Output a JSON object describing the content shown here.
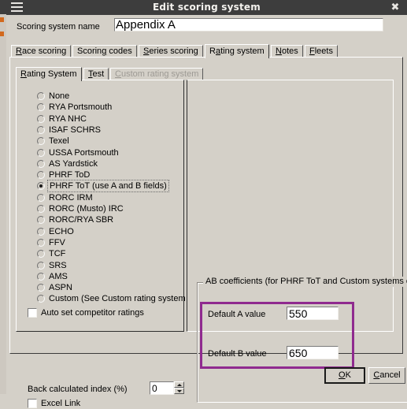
{
  "window": {
    "title": "Edit scoring system",
    "menu_icon": "hamburger-menu-icon",
    "close_icon": "✖"
  },
  "name_row": {
    "label": "Scoring system name",
    "value": "Appendix A",
    "placeholder": ""
  },
  "outer_tabs": [
    {
      "label": "Race scoring",
      "accel": "R",
      "selected": false
    },
    {
      "label": "Scoring codes",
      "accel": "g",
      "selected": false
    },
    {
      "label": "Series scoring",
      "accel": "S",
      "selected": false
    },
    {
      "label": "Rating system",
      "accel": "a",
      "selected": true
    },
    {
      "label": "Notes",
      "accel": "N",
      "selected": false
    },
    {
      "label": "Fleets",
      "accel": "F",
      "selected": false
    }
  ],
  "inner_tabs": [
    {
      "label": "Rating System",
      "accel": "R",
      "selected": true,
      "disabled": false
    },
    {
      "label": "Test",
      "accel": "T",
      "selected": false,
      "disabled": false
    },
    {
      "label": "Custom rating system",
      "accel": "C",
      "selected": false,
      "disabled": true
    }
  ],
  "rating_systems": [
    {
      "label": "None",
      "checked": false
    },
    {
      "label": "RYA Portsmouth",
      "checked": false
    },
    {
      "label": "RYA NHC",
      "checked": false
    },
    {
      "label": "ISAF SCHRS",
      "checked": false
    },
    {
      "label": "Texel",
      "checked": false
    },
    {
      "label": "USSA Portsmouth",
      "checked": false
    },
    {
      "label": "AS Yardstick",
      "checked": false
    },
    {
      "label": "PHRF ToD",
      "checked": false
    },
    {
      "label": "PHRF ToT (use A and B fields)",
      "checked": true
    },
    {
      "label": "RORC IRM",
      "checked": false
    },
    {
      "label": "RORC (Musto) IRC",
      "checked": false
    },
    {
      "label": "RORC/RYA SBR",
      "checked": false
    },
    {
      "label": "ECHO",
      "checked": false
    },
    {
      "label": "FFV",
      "checked": false
    },
    {
      "label": "TCF",
      "checked": false
    },
    {
      "label": "SRS",
      "checked": false
    },
    {
      "label": "AMS",
      "checked": false
    },
    {
      "label": "ASPN",
      "checked": false
    },
    {
      "label": "Custom (See Custom rating system tab)",
      "checked": false
    }
  ],
  "auto_set": {
    "label": "Auto set competitor ratings",
    "checked": false
  },
  "back_index": {
    "label": "Back calculated index (%)",
    "value": "0"
  },
  "excel_link": {
    "label": "Excel Link",
    "checked": false
  },
  "ab_group": {
    "title": "AB coefficients (for PHRF ToT and Custom systems only)",
    "a_label": "Default A value",
    "a_value": "550",
    "b_label": "Default B value",
    "b_value": "650",
    "highlight_color": "#8f2a8f"
  },
  "buttons": {
    "ok": "OK",
    "ok_accel": "O",
    "cancel": "Cancel",
    "cancel_accel": "C"
  },
  "colors": {
    "dialog_face": "#d4d0c8",
    "titlebar": "#3d3d3d",
    "titlebar_text": "#f4f2ee",
    "field_bg": "#ffffff",
    "highlight": "#8f2a8f"
  }
}
